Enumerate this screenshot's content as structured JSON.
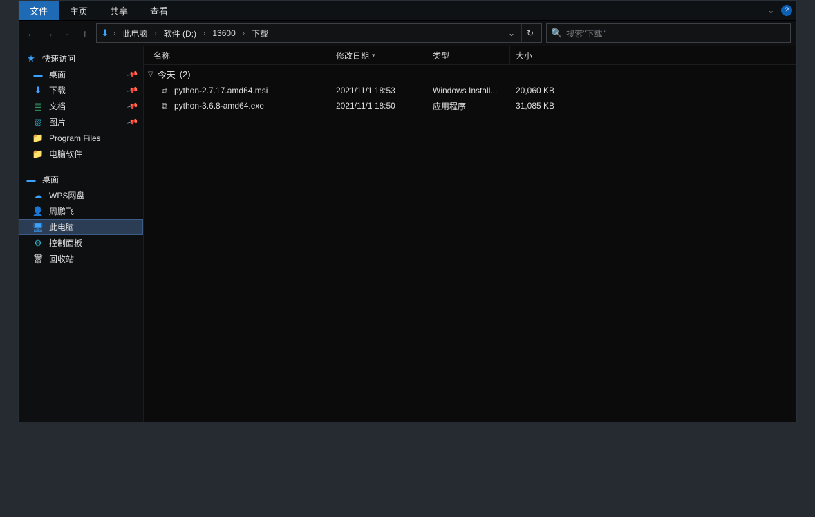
{
  "ribbon": {
    "tabs": [
      "文件",
      "主页",
      "共享",
      "查看"
    ]
  },
  "breadcrumbs": [
    "此电脑",
    "软件 (D:)",
    "13600",
    "下载"
  ],
  "search": {
    "placeholder": "搜索\"下载\""
  },
  "navpane": {
    "quick_access": {
      "label": "快速访问",
      "items": [
        {
          "label": "桌面",
          "icon": "desktop",
          "color": "c-blue",
          "pinned": true
        },
        {
          "label": "下载",
          "icon": "download",
          "color": "c-blue",
          "pinned": true
        },
        {
          "label": "文档",
          "icon": "doc",
          "color": "c-green",
          "pinned": true
        },
        {
          "label": "图片",
          "icon": "pic",
          "color": "c-cyan",
          "pinned": true
        },
        {
          "label": "Program Files",
          "icon": "folder",
          "color": "c-folder",
          "pinned": false
        },
        {
          "label": "电脑软件",
          "icon": "folder",
          "color": "c-folder",
          "pinned": false
        }
      ]
    },
    "desktop": {
      "label": "桌面",
      "items": [
        {
          "label": "WPS网盘",
          "icon": "cloud",
          "color": "c-blue"
        },
        {
          "label": "周鹏飞",
          "icon": "user",
          "color": "c-green"
        },
        {
          "label": "此电脑",
          "icon": "pc",
          "color": "c-blue",
          "selected": true
        },
        {
          "label": "控制面板",
          "icon": "panel",
          "color": "c-cyan"
        },
        {
          "label": "回收站",
          "icon": "trash",
          "color": "c-white"
        }
      ]
    }
  },
  "columns": {
    "name": "名称",
    "date": "修改日期",
    "type": "类型",
    "size": "大小"
  },
  "group": {
    "label": "今天",
    "count": "(2)"
  },
  "files": [
    {
      "name": "python-2.7.17.amd64.msi",
      "date": "2021/11/1 18:53",
      "type": "Windows Install...",
      "size": "20,060 KB",
      "icon": "msi"
    },
    {
      "name": "python-3.6.8-amd64.exe",
      "date": "2021/11/1 18:50",
      "type": "应用程序",
      "size": "31,085 KB",
      "icon": "exe"
    }
  ]
}
